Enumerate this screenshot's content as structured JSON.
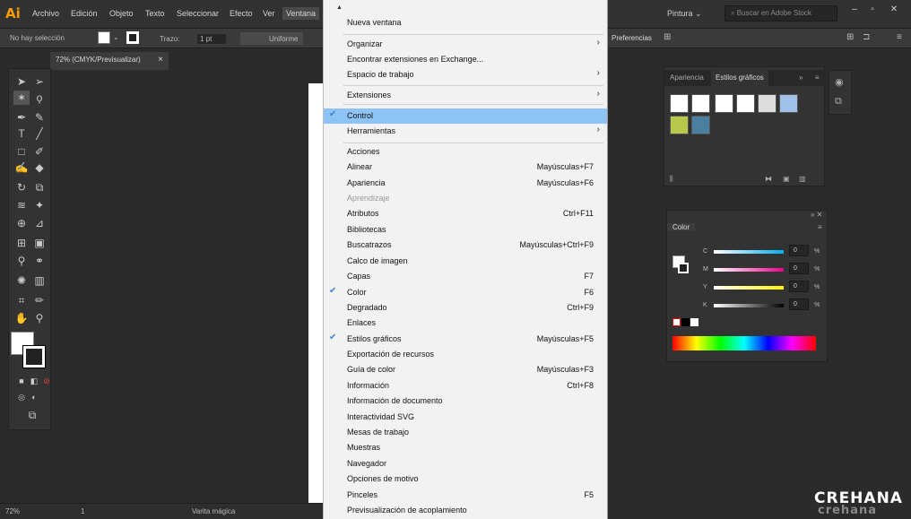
{
  "app": {
    "logo": "Ai",
    "workspace": "Pintura",
    "stock_placeholder": "Buscar en Adobe Stock"
  },
  "menubar": [
    "Archivo",
    "Edición",
    "Objeto",
    "Texto",
    "Seleccionar",
    "Efecto",
    "Ver",
    "Ventana"
  ],
  "control_bar": {
    "selection": "No hay selección",
    "stroke_label": "Trazo:",
    "stroke_weight": "1 pt",
    "profile": "Uniforme",
    "prefs": "Preferencias"
  },
  "doc_tab": {
    "title": "72% (CMYK/Previsualizar)",
    "close": "×"
  },
  "menu": {
    "items": [
      {
        "label": "Nueva ventana",
        "shortcut": "",
        "arrow": false,
        "checked": false,
        "disabled": false,
        "highlight": false
      },
      {
        "label": "Organizar",
        "shortcut": "",
        "arrow": true,
        "checked": false,
        "disabled": false,
        "highlight": false
      },
      {
        "label": "Encontrar extensiones en Exchange...",
        "shortcut": "",
        "arrow": false,
        "checked": false,
        "disabled": false,
        "highlight": false
      },
      {
        "label": "Espacio de trabajo",
        "shortcut": "",
        "arrow": true,
        "checked": false,
        "disabled": false,
        "highlight": false
      },
      {
        "label": "Extensiones",
        "shortcut": "",
        "arrow": true,
        "checked": false,
        "disabled": false,
        "highlight": false
      },
      {
        "label": "Control",
        "shortcut": "",
        "arrow": false,
        "checked": true,
        "disabled": false,
        "highlight": true
      },
      {
        "label": "Herramientas",
        "shortcut": "",
        "arrow": true,
        "checked": false,
        "disabled": false,
        "highlight": false
      },
      {
        "label": "Acciones",
        "shortcut": "",
        "arrow": false,
        "checked": false,
        "disabled": false,
        "highlight": false
      },
      {
        "label": "Alinear",
        "shortcut": "Mayúsculas+F7",
        "arrow": false,
        "checked": false,
        "disabled": false,
        "highlight": false
      },
      {
        "label": "Apariencia",
        "shortcut": "Mayúsculas+F6",
        "arrow": false,
        "checked": false,
        "disabled": false,
        "highlight": false
      },
      {
        "label": "Aprendizaje",
        "shortcut": "",
        "arrow": false,
        "checked": false,
        "disabled": true,
        "highlight": false
      },
      {
        "label": "Atributos",
        "shortcut": "Ctrl+F11",
        "arrow": false,
        "checked": false,
        "disabled": false,
        "highlight": false
      },
      {
        "label": "Bibliotecas",
        "shortcut": "",
        "arrow": false,
        "checked": false,
        "disabled": false,
        "highlight": false
      },
      {
        "label": "Buscatrazos",
        "shortcut": "Mayúsculas+Ctrl+F9",
        "arrow": false,
        "checked": false,
        "disabled": false,
        "highlight": false
      },
      {
        "label": "Calco de imagen",
        "shortcut": "",
        "arrow": false,
        "checked": false,
        "disabled": false,
        "highlight": false
      },
      {
        "label": "Capas",
        "shortcut": "F7",
        "arrow": false,
        "checked": false,
        "disabled": false,
        "highlight": false
      },
      {
        "label": "Color",
        "shortcut": "F6",
        "arrow": false,
        "checked": true,
        "disabled": false,
        "highlight": false
      },
      {
        "label": "Degradado",
        "shortcut": "Ctrl+F9",
        "arrow": false,
        "checked": false,
        "disabled": false,
        "highlight": false
      },
      {
        "label": "Enlaces",
        "shortcut": "",
        "arrow": false,
        "checked": false,
        "disabled": false,
        "highlight": false
      },
      {
        "label": "Estilos gráficos",
        "shortcut": "Mayúsculas+F5",
        "arrow": false,
        "checked": true,
        "disabled": false,
        "highlight": false
      },
      {
        "label": "Exportación de recursos",
        "shortcut": "",
        "arrow": false,
        "checked": false,
        "disabled": false,
        "highlight": false
      },
      {
        "label": "Guía de color",
        "shortcut": "Mayúsculas+F3",
        "arrow": false,
        "checked": false,
        "disabled": false,
        "highlight": false
      },
      {
        "label": "Información",
        "shortcut": "Ctrl+F8",
        "arrow": false,
        "checked": false,
        "disabled": false,
        "highlight": false
      },
      {
        "label": "Información de documento",
        "shortcut": "",
        "arrow": false,
        "checked": false,
        "disabled": false,
        "highlight": false
      },
      {
        "label": "Interactividad SVG",
        "shortcut": "",
        "arrow": false,
        "checked": false,
        "disabled": false,
        "highlight": false
      },
      {
        "label": "Mesas de trabajo",
        "shortcut": "",
        "arrow": false,
        "checked": false,
        "disabled": false,
        "highlight": false
      },
      {
        "label": "Muestras",
        "shortcut": "",
        "arrow": false,
        "checked": false,
        "disabled": false,
        "highlight": false
      },
      {
        "label": "Navegador",
        "shortcut": "",
        "arrow": false,
        "checked": false,
        "disabled": false,
        "highlight": false
      },
      {
        "label": "Opciones de motivo",
        "shortcut": "",
        "arrow": false,
        "checked": false,
        "disabled": false,
        "highlight": false
      },
      {
        "label": "Pinceles",
        "shortcut": "F5",
        "arrow": false,
        "checked": false,
        "disabled": false,
        "highlight": false
      },
      {
        "label": "Previsualización de acoplamiento",
        "shortcut": "",
        "arrow": false,
        "checked": false,
        "disabled": false,
        "highlight": false
      }
    ]
  },
  "appearance_panel": {
    "tab1": "Apariencia",
    "tab2": "Estilos gráficos"
  },
  "color_panel": {
    "title": "Color",
    "sliders": [
      {
        "label": "C",
        "value": "0"
      },
      {
        "label": "M",
        "value": "0"
      },
      {
        "label": "Y",
        "value": "0"
      },
      {
        "label": "K",
        "value": "0"
      }
    ],
    "pct": "%"
  },
  "status": {
    "zoom": "72%",
    "page": "1",
    "tool": "Varita mágica"
  },
  "watermark": {
    "line1": "CREHANA",
    "line2": "crehana"
  },
  "colors": {
    "menu_highlight": "#8ec3f5",
    "check": "#3b80d0",
    "logo": "#ff9a00"
  }
}
